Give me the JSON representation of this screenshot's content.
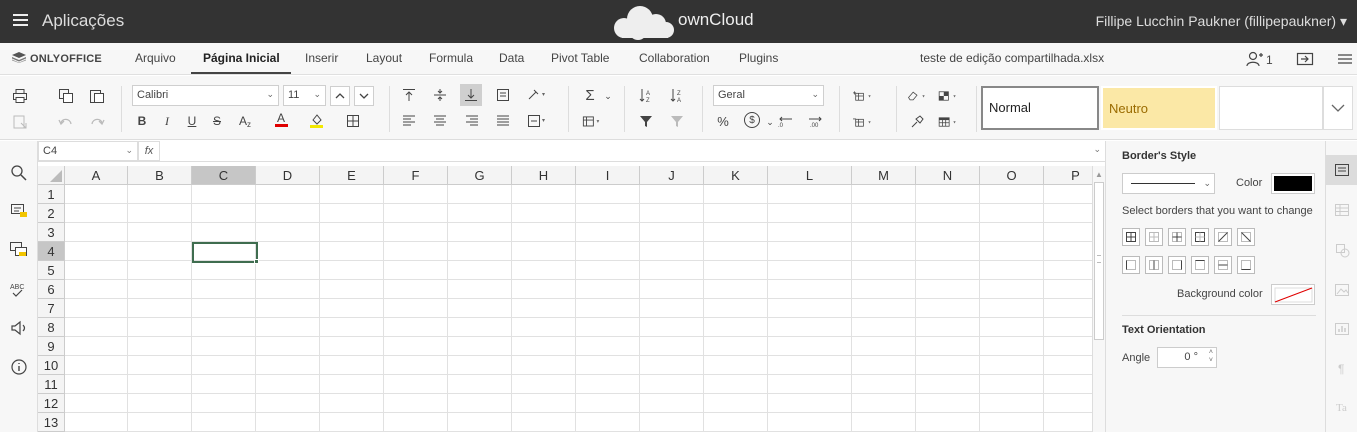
{
  "topbar": {
    "apps_label": "Aplicações",
    "brand": "ownCloud",
    "user": "Fillipe Lucchin Paukner (fillipepaukner)",
    "user_caret": "▾"
  },
  "editor": {
    "logo_text": "ONLYOFFICE",
    "tabs": [
      "Arquivo",
      "Página Inicial",
      "Inserir",
      "Layout",
      "Formula",
      "Data",
      "Pivot Table",
      "Collaboration",
      "Plugins"
    ],
    "active_tab": "Página Inicial",
    "doc_title": "teste de edição compartilhada.xlsx",
    "users_count": "1"
  },
  "ribbon": {
    "font_name": "Calibri",
    "font_size": "11",
    "number_format": "Geral",
    "bold": "B",
    "italic": "I",
    "underline": "U",
    "strike": "S",
    "subscript": "A",
    "font_color_letter": "A",
    "sum": "Σ",
    "percent": "%",
    "currency": "$",
    "styles": {
      "normal": "Normal",
      "neutro": "Neutro"
    },
    "colors": {
      "font_color": "#e00000",
      "fill_color": "#f2e800",
      "neutro_bg": "#fbe8a6"
    }
  },
  "formula": {
    "cell_ref": "C4",
    "fx": "fx",
    "value": ""
  },
  "grid": {
    "columns": [
      "A",
      "B",
      "C",
      "D",
      "E",
      "F",
      "G",
      "H",
      "I",
      "J",
      "K",
      "L",
      "M",
      "N",
      "O",
      "P"
    ],
    "rows": [
      "1",
      "2",
      "3",
      "4",
      "5",
      "6",
      "7",
      "8",
      "9",
      "10",
      "11",
      "12",
      "13"
    ],
    "selected_col": "C",
    "selected_row": "4"
  },
  "panel": {
    "borders_style_title": "Border's Style",
    "color_label": "Color",
    "border_color": "#000000",
    "select_borders_label": "Select borders that you want to change",
    "background_color_label": "Background color",
    "text_orientation_title": "Text Orientation",
    "angle_label": "Angle",
    "angle_value": "0 °"
  }
}
